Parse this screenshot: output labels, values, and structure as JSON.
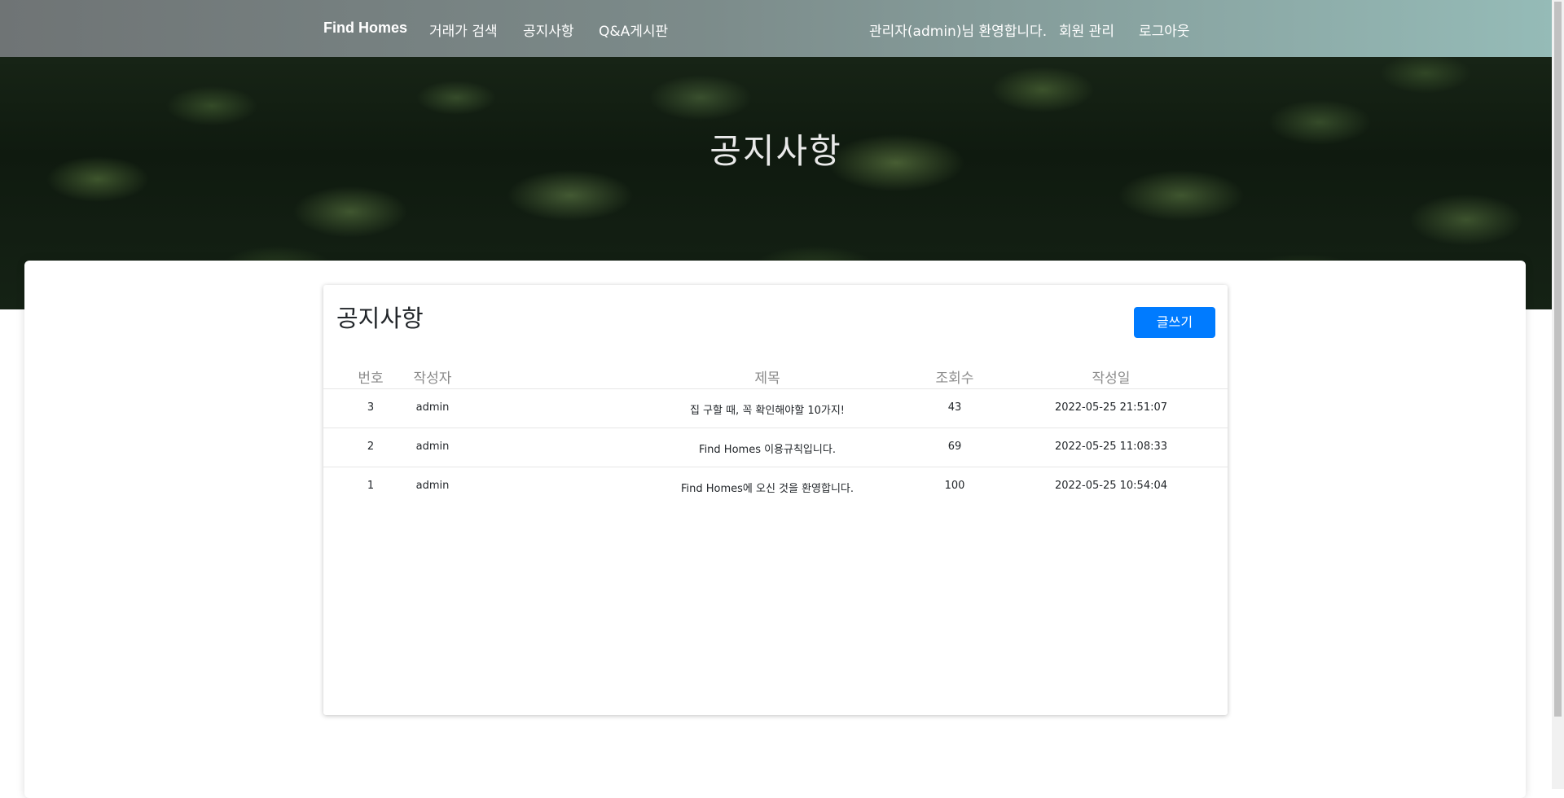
{
  "navbar": {
    "brand": "Find Homes",
    "links": [
      {
        "label": "거래가 검색"
      },
      {
        "label": "공지사항"
      },
      {
        "label": "Q&A게시판"
      }
    ],
    "welcome": "관리자(admin)님 환영합니다.",
    "member_manage": "회원 관리",
    "logout": "로그아웃"
  },
  "hero": {
    "title": "공지사항"
  },
  "board": {
    "heading": "공지사항",
    "write_label": "글쓰기",
    "columns": [
      "번호",
      "작성자",
      "제목",
      "조회수",
      "작성일"
    ],
    "rows": [
      {
        "num": "3",
        "writer": "admin",
        "title": "집 구할 때, 꼭 확인해야할 10가지!",
        "views": "43",
        "date": "2022-05-25 21:51:07"
      },
      {
        "num": "2",
        "writer": "admin",
        "title": "Find Homes 이용규칙입니다.",
        "views": "69",
        "date": "2022-05-25 11:08:33"
      },
      {
        "num": "1",
        "writer": "admin",
        "title": "Find Homes에 오신 것을 환영합니다.",
        "views": "100",
        "date": "2022-05-25 10:54:04"
      }
    ]
  },
  "colors": {
    "accent": "#007bff",
    "navbar_start": "#6f7475",
    "navbar_end": "#95bbb7"
  }
}
